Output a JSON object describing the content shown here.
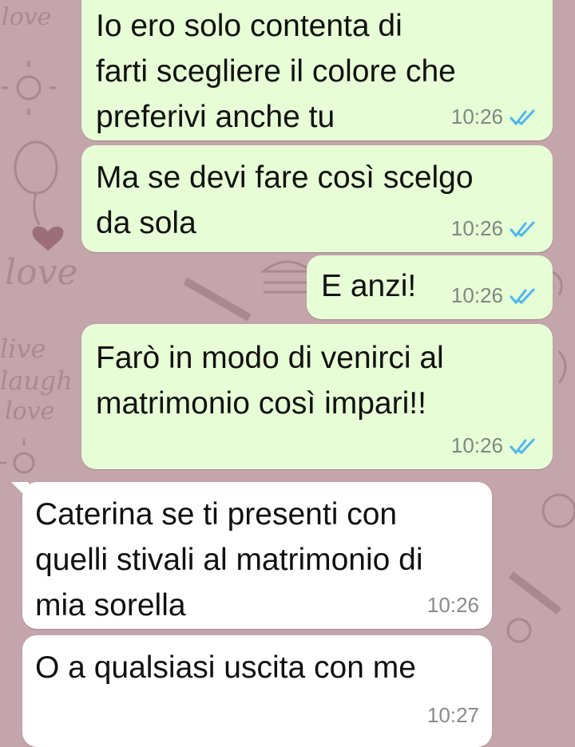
{
  "chat": {
    "messages": [
      {
        "direction": "outgoing",
        "text_lines": [
          "Io ero solo contenta di",
          "farti scegliere il colore che",
          "preferivi anche tu"
        ],
        "time": "10:26",
        "status": "read"
      },
      {
        "direction": "outgoing",
        "text_lines": [
          "Ma se devi fare così scelgo",
          "da sola"
        ],
        "time": "10:26",
        "status": "read"
      },
      {
        "direction": "outgoing",
        "text_lines": [
          "E anzi!"
        ],
        "time": "10:26",
        "status": "read"
      },
      {
        "direction": "outgoing",
        "text_lines": [
          "Farò in modo di venirci al",
          "matrimonio così impari!!"
        ],
        "time": "10:26",
        "status": "read"
      },
      {
        "direction": "incoming",
        "text_lines": [
          "Caterina se ti presenti con",
          "quelli stivali al matrimonio di",
          "mia sorella"
        ],
        "time": "10:26"
      },
      {
        "direction": "incoming",
        "text_lines": [
          "O a qualsiasi uscita con me"
        ],
        "time": "10:27"
      }
    ]
  },
  "wallpaper": {
    "doodle_words": [
      "love",
      "love",
      "live",
      "laugh",
      "love"
    ]
  },
  "colors": {
    "wallpaper": "#c3a5ab",
    "outgoing_bubble": "#e6fdd6",
    "incoming_bubble": "#ffffff",
    "read_tick": "#4fb6ec",
    "timestamp": "#7b8a80"
  },
  "icons": {
    "read_receipt": "double-check-icon"
  }
}
